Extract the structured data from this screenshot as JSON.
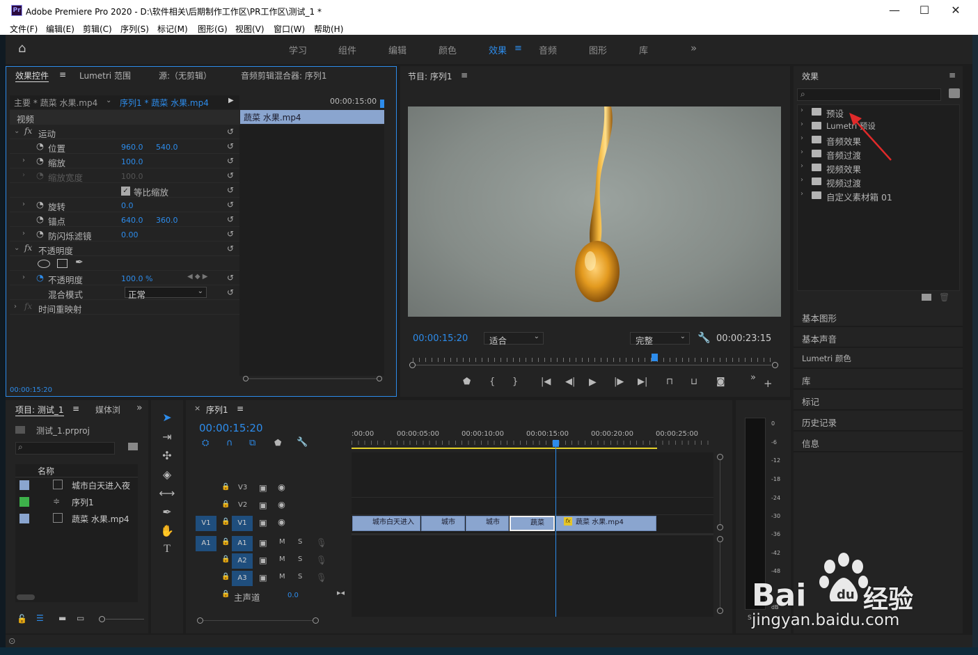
{
  "window": {
    "title": "Adobe Premiere Pro 2020 - D:\\软件相关\\后期制作工作区\\PR工作区\\测试_1 *",
    "logo": "Pr",
    "minimize": "—",
    "maximize": "☐",
    "close": "✕"
  },
  "menu": [
    "文件(F)",
    "编辑(E)",
    "剪辑(C)",
    "序列(S)",
    "标记(M)",
    "图形(G)",
    "视图(V)",
    "窗口(W)",
    "帮助(H)"
  ],
  "workspaces": {
    "home": "⌂",
    "items": [
      "学习",
      "组件",
      "编辑",
      "颜色",
      "效果",
      "音频",
      "图形",
      "库"
    ],
    "active": "效果",
    "menu_glyph": "≡",
    "more": "»"
  },
  "effect_controls": {
    "tabs": [
      "效果控件",
      "Lumetri 范围",
      "源:（无剪辑）",
      "音频剪辑混合器: 序列1"
    ],
    "master": "主要 * 蔬菜 水果.mp4",
    "sequence": "序列1 * 蔬菜 水果.mp4",
    "timecode_top": "00:00:15:00",
    "clip_label": "蔬菜 水果.mp4",
    "video_label": "视频",
    "motion": "运动",
    "position": "位置",
    "pos_x": "960.0",
    "pos_y": "540.0",
    "scale": "缩放",
    "scale_val": "100.0",
    "scale_w": "缩放宽度",
    "scale_w_val": "100.0",
    "uniform": "等比缩放",
    "rotation": "旋转",
    "rot_val": "0.0",
    "anchor": "锚点",
    "anc_x": "640.0",
    "anc_y": "360.0",
    "flicker": "防闪烁滤镜",
    "flicker_val": "0.00",
    "opacity_group": "不透明度",
    "opacity": "不透明度",
    "opacity_val": "100.0 %",
    "blend": "混合模式",
    "blend_val": "正常",
    "time_remap": "时间重映射",
    "timecode_bottom": "00:00:15:20",
    "fx": "fx"
  },
  "program": {
    "title": "节目: 序列1",
    "timecode": "00:00:15:20",
    "fit": "适合",
    "quality": "完整",
    "duration": "00:00:23:15"
  },
  "effects_panel": {
    "title": "效果",
    "items": [
      "预设",
      "Lumetri 预设",
      "音频效果",
      "音频过渡",
      "视频效果",
      "视频过渡",
      "自定义素材箱 01"
    ]
  },
  "side_panels": [
    "基本图形",
    "基本声音",
    "Lumetri 颜色",
    "库",
    "标记",
    "历史记录",
    "信息"
  ],
  "project": {
    "tabs": [
      "项目: 测试_1",
      "媒体浏"
    ],
    "file": "测试_1.prproj",
    "col_name": "名称",
    "items": [
      {
        "name": "城市白天进入夜",
        "color": "#8aa5cf"
      },
      {
        "name": "序列1",
        "color": "#3db14a"
      },
      {
        "name": "蔬菜 水果.mp4",
        "color": "#8aa5cf"
      }
    ]
  },
  "timeline": {
    "tab": "序列1",
    "timecode": "00:00:15:20",
    "ruler": [
      ":00:00",
      "00:00:05:00",
      "00:00:10:00",
      "00:00:15:00",
      "00:00:20:00",
      "00:00:25:00"
    ],
    "video_tracks": [
      "V3",
      "V2",
      "V1"
    ],
    "audio_tracks": [
      "A1",
      "A2",
      "A3"
    ],
    "src_v": "V1",
    "src_a": "A1",
    "m": "M",
    "s": "S",
    "master": "主声道",
    "master_val": "0.0",
    "clips": [
      "城市白天进入",
      "城市",
      "城市",
      "蔬菜",
      "蔬菜 水果.mp4"
    ]
  },
  "meter": {
    "ticks": [
      "0",
      "-6",
      "-12",
      "-18",
      "-24",
      "-30",
      "-36",
      "-42",
      "-48",
      "dB"
    ],
    "s": "S"
  },
  "watermark": {
    "brand": "Bai",
    "cn": "经验",
    "url": "jingyan.baidu.com"
  }
}
